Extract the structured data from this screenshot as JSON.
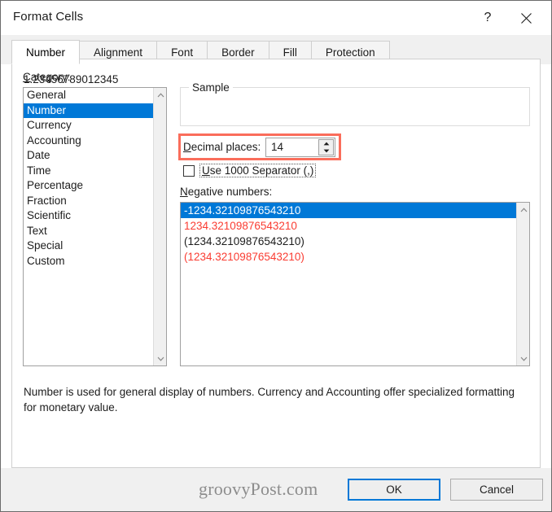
{
  "window": {
    "title": "Format Cells",
    "help_icon": "question-mark-icon",
    "close_icon": "close-icon"
  },
  "tabs": [
    {
      "label": "Number",
      "active": true
    },
    {
      "label": "Alignment",
      "active": false
    },
    {
      "label": "Font",
      "active": false
    },
    {
      "label": "Border",
      "active": false
    },
    {
      "label": "Fill",
      "active": false
    },
    {
      "label": "Protection",
      "active": false
    }
  ],
  "category": {
    "label": "Category:",
    "label_accel": "C",
    "items": [
      "General",
      "Number",
      "Currency",
      "Accounting",
      "Date",
      "Time",
      "Percentage",
      "Fraction",
      "Scientific",
      "Text",
      "Special",
      "Custom"
    ],
    "selected": "Number",
    "selected_index": 1
  },
  "sample": {
    "legend": "Sample",
    "value": "1.23456789012345"
  },
  "decimal_places": {
    "label": "Decimal places:",
    "label_accel": "D",
    "value": "14",
    "spin_up_icon": "spinner-up-arrow-icon",
    "spin_down_icon": "spinner-down-arrow-icon",
    "highlight_color": "#fa6d5b",
    "highlighted": true
  },
  "thousands_separator": {
    "label": "Use 1000 Separator (,)",
    "label_accel": "U",
    "checked": false,
    "focused": true
  },
  "negative_numbers": {
    "label": "Negative numbers:",
    "label_accel": "N",
    "items": [
      {
        "text": "-1234.32109876543210",
        "color": "black",
        "selected": true
      },
      {
        "text": "1234.32109876543210",
        "color": "red",
        "selected": false
      },
      {
        "text": "(1234.32109876543210)",
        "color": "black",
        "selected": false
      },
      {
        "text": "(1234.32109876543210)",
        "color": "red",
        "selected": false
      }
    ],
    "selected_index": 0,
    "red_hex": "#fa3c32",
    "selection_hex": "#0078d7"
  },
  "description": "Number is used for general display of numbers.  Currency and Accounting offer specialized formatting for monetary value.",
  "footer": {
    "watermark": "groovyPost.com",
    "ok_label": "OK",
    "cancel_label": "Cancel",
    "focus_color": "#0078d7"
  },
  "scrollbars": {
    "up_icon": "chevron-up-icon",
    "down_icon": "chevron-down-icon"
  }
}
